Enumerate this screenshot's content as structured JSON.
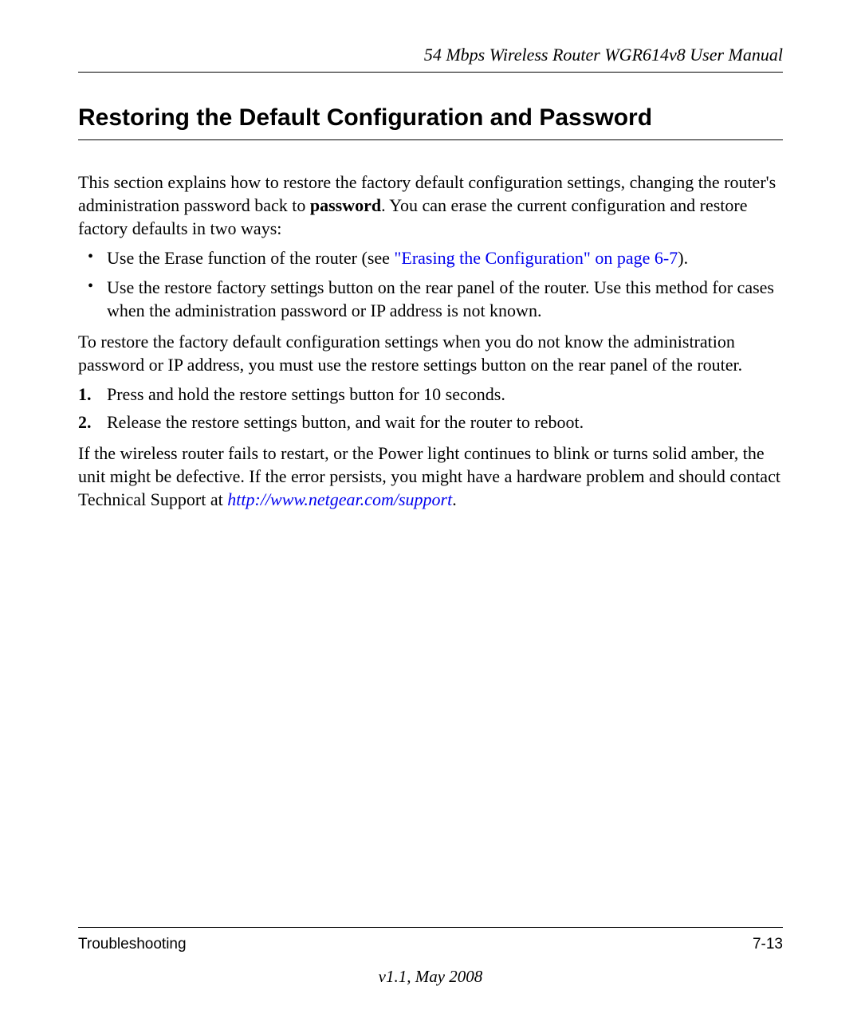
{
  "header": {
    "doc_title": "54 Mbps Wireless Router WGR614v8 User Manual"
  },
  "section": {
    "title": "Restoring the Default Configuration and Password"
  },
  "content": {
    "intro_part1": "This section explains how to restore the factory default configuration settings, changing the router's administration password back to ",
    "intro_bold": "password",
    "intro_part2": ". You can erase the current configuration and restore factory defaults in two ways:",
    "bullet1_part1": "Use the Erase function of the router (see ",
    "bullet1_link": "\"Erasing the Configuration\" on page 6-7",
    "bullet1_part2": ").",
    "bullet2": "Use the restore factory settings button on the rear panel of the router. Use this method for cases when the administration password or IP address is not known.",
    "para2": "To restore the factory default configuration settings when you do not know the administration password or IP address, you must use the restore settings button on the rear panel of the router.",
    "step1_num": "1.",
    "step1": "Press and hold the restore settings button for 10 seconds.",
    "step2_num": "2.",
    "step2": "Release the restore settings button, and wait for the router to reboot.",
    "para3_part1": "If the wireless router fails to restart, or the Power light continues to blink or turns solid amber, the unit might be defective. If the error persists, you might have a hardware problem and should contact Technical Support at ",
    "para3_link": "http://www.netgear.com/support",
    "para3_part2": "."
  },
  "footer": {
    "section_name": "Troubleshooting",
    "page_num": "7-13",
    "version": "v1.1, May 2008"
  }
}
